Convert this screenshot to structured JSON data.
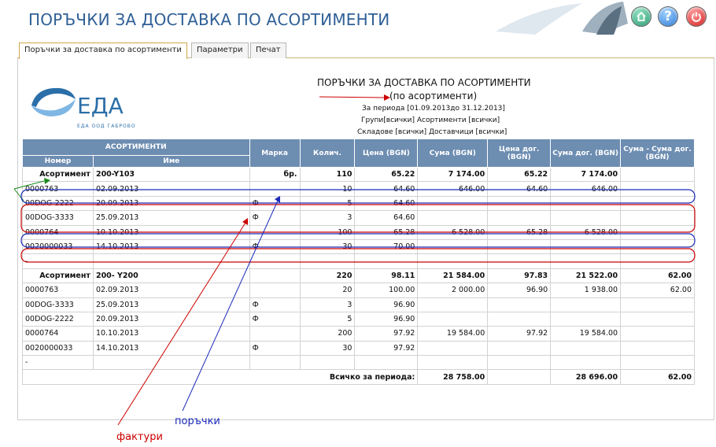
{
  "app": {
    "title": "ПОРЪЧКИ ЗА ДОСТАВКА ПО АСОРТИМЕНТИ",
    "help_label": "?"
  },
  "tabs": [
    {
      "label": "Поръчки за доставка по асортименти",
      "active": true
    },
    {
      "label": "Параметри",
      "active": false
    },
    {
      "label": "Печат",
      "active": false
    }
  ],
  "logo": {
    "name": "ЕДА",
    "subtitle": "ЕДА ООД ГАБРОВО"
  },
  "report": {
    "title": "ПОРЪЧКИ ЗА ДОСТАВКА ПО АСОРТИМЕНТИ",
    "subtitle": "(по асортименти)",
    "period": "За периода [01.09.2013до 31.12.2013]",
    "filters1": "Групи[всички] Асортименти [всички]",
    "filters2": "Складове [всички] Доставчици [всички]"
  },
  "table": {
    "headers": {
      "asortimenti": "АСОРТИМЕНТИ",
      "nomer": "Номер",
      "ime": "Име",
      "marka": "Марка",
      "kolich": "Колич.",
      "cena": "Цена (BGN)",
      "suma": "Сума (BGN)",
      "cena_dog": "Цена дог. (BGN)",
      "suma_dog": "Сума дог. (BGN)",
      "suma_diff": "Сума - Сума дог. (BGN)"
    },
    "rows": [
      {
        "type": "group",
        "c": [
          "Асортимент",
          "200-Y103",
          "бр.",
          "110",
          "65.22",
          "7 174.00",
          "65.22",
          "7 174.00",
          ""
        ]
      },
      {
        "type": "data",
        "c": [
          "0000763",
          "02.09.2013",
          "",
          "10",
          "64.60",
          "646.00",
          "64.60",
          "646.00",
          ""
        ]
      },
      {
        "type": "data",
        "c": [
          "00DOG-2222",
          "20.09.2013",
          "Ф",
          "5",
          "64.60",
          "",
          "",
          "",
          ""
        ]
      },
      {
        "type": "data",
        "c": [
          "00DOG-3333",
          "25.09.2013",
          "Ф",
          "3",
          "64.60",
          "",
          "",
          "",
          ""
        ]
      },
      {
        "type": "data",
        "c": [
          "0000764",
          "10.10.2013",
          "",
          "100",
          "65.28",
          "6 528.00",
          "65.28",
          "6 528.00",
          ""
        ]
      },
      {
        "type": "data",
        "c": [
          "0020000033",
          "14.10.2013",
          "Ф",
          "30",
          "70.00",
          "",
          "",
          "",
          ""
        ]
      },
      {
        "type": "sep",
        "c": [
          "-",
          "",
          "",
          "",
          "",
          "",
          "",
          "",
          ""
        ]
      },
      {
        "type": "group",
        "c": [
          "Асортимент",
          "200- Y200",
          "",
          "220",
          "98.11",
          "21 584.00",
          "97.83",
          "21 522.00",
          "62.00"
        ]
      },
      {
        "type": "data",
        "c": [
          "0000763",
          "02.09.2013",
          "",
          "20",
          "100.00",
          "2 000.00",
          "96.90",
          "1 938.00",
          "62.00"
        ]
      },
      {
        "type": "data",
        "c": [
          "00DOG-3333",
          "25.09.2013",
          "Ф",
          "3",
          "96.90",
          "",
          "",
          "",
          ""
        ]
      },
      {
        "type": "data",
        "c": [
          "00DOG-2222",
          "20.09.2013",
          "Ф",
          "5",
          "96.90",
          "",
          "",
          "",
          ""
        ]
      },
      {
        "type": "data",
        "c": [
          "0000764",
          "10.10.2013",
          "",
          "200",
          "97.92",
          "19 584.00",
          "97.92",
          "19 584.00",
          ""
        ]
      },
      {
        "type": "data",
        "c": [
          "0020000033",
          "14.10.2013",
          "Ф",
          "30",
          "97.92",
          "",
          "",
          "",
          ""
        ]
      },
      {
        "type": "sep",
        "c": [
          "-",
          "",
          "",
          "",
          "",
          "",
          "",
          "",
          ""
        ]
      }
    ],
    "total": {
      "label": "Всичко за периода:",
      "suma": "28 758.00",
      "suma_dog": "28 696.00",
      "diff": "62.00"
    }
  },
  "annotations": {
    "orders": "поръчки",
    "invoices": "фактури"
  },
  "colors": {
    "title": "#2f5f96",
    "header_bg": "#6d8db1",
    "orders": "#1a2ab8",
    "invoices": "#cc0000",
    "groups": "#1a8a1a"
  }
}
